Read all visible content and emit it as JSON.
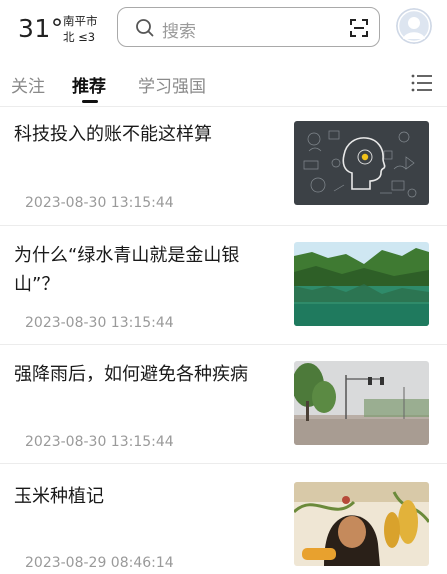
{
  "weather": {
    "temperature": "31°",
    "city": "南平市",
    "wind": "北 ≤3"
  },
  "search": {
    "placeholder": "搜索",
    "icon": "search-icon",
    "scan_icon": "scan-icon"
  },
  "avatar": {
    "icon": "user-avatar"
  },
  "tabs": [
    {
      "label": "关注",
      "active": false
    },
    {
      "label": "推荐",
      "active": true
    },
    {
      "label": "学习强国",
      "active": false
    }
  ],
  "menu_icon": "list-menu-icon",
  "articles": [
    {
      "title": "科技投入的账不能这样算",
      "date": "2023-08-30 13:15:44",
      "thumbnail": "tech-head-illustration"
    },
    {
      "title": "为什么“绿水青山就是金山银山”？",
      "date": "2023-08-30 13:15:44",
      "thumbnail": "green-mountains-lake"
    },
    {
      "title": "强降雨后，如何避免各种疾病",
      "date": "2023-08-30 13:15:44",
      "thumbnail": "flooded-street"
    },
    {
      "title": "玉米种植记",
      "date": "2023-08-29 08:46:14",
      "thumbnail": "corn-painting"
    }
  ],
  "colors": {
    "accent": "#111111",
    "secondary_text": "#9a9a9a",
    "divider": "#ececec"
  }
}
